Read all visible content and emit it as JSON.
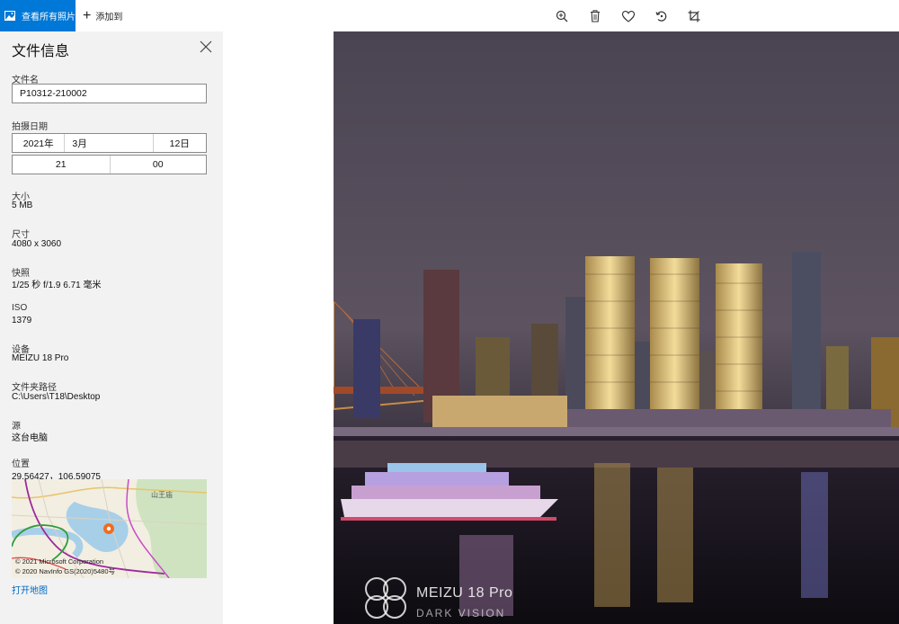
{
  "toolbar": {
    "view_all_label": "查看所有照片",
    "add_to_label": "添加到",
    "tools": [
      "zoom-in-icon",
      "delete-icon",
      "favorite-icon",
      "rotate-icon",
      "crop-icon"
    ]
  },
  "panel": {
    "title": "文件信息",
    "file_name": {
      "label": "文件名",
      "value": "P10312-210002"
    },
    "date_taken": {
      "label": "拍摄日期",
      "year": "2021年",
      "month": "3月",
      "day": "12日",
      "hour": "21",
      "minute": "00"
    },
    "size": {
      "label": "大小",
      "value": "5 MB"
    },
    "dimensions": {
      "label": "尺寸",
      "value": "4080 x 3060"
    },
    "snapshot": {
      "label": "快照",
      "value": "1/25 秒 f/1.9 6.71 毫米"
    },
    "iso": {
      "label": "ISO",
      "value": "1379"
    },
    "device": {
      "label": "设备",
      "value": "MEIZU 18 Pro"
    },
    "folder": {
      "label": "文件夹路径",
      "value": "C:\\Users\\T18\\Desktop"
    },
    "source": {
      "label": "源",
      "value": "这台电脑"
    },
    "location": {
      "label": "位置",
      "value": "29.56427，106.59075"
    },
    "map": {
      "place_label": "山王庙",
      "copyright_1": "© 2021 Microsoft Corporation",
      "copyright_2": "© 2020 NavInfo GS(2020)5480号"
    },
    "open_map_label": "打开地图"
  },
  "photo": {
    "watermark_title": "MEIZU 18 Pro",
    "watermark_sub": "DARK VISION"
  },
  "colors": {
    "accent": "#0078d7",
    "panel_bg": "#f2f2f2",
    "link": "#0067c0"
  }
}
